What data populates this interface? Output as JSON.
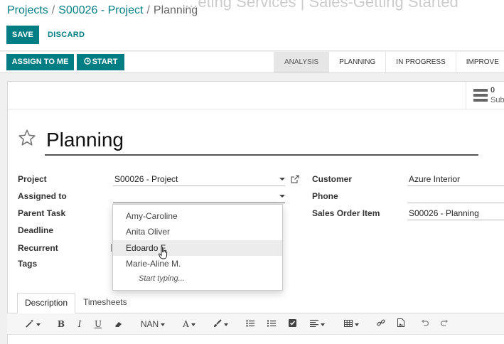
{
  "header": {
    "blurred_title": "...eting Services | Sales-Getting Started",
    "breadcrumbs": [
      {
        "label": "Projects"
      },
      {
        "label": "S00026 - Project"
      },
      {
        "label": "Planning"
      }
    ],
    "separator": "/",
    "save_label": "SAVE",
    "discard_label": "DISCARD"
  },
  "statusbar": {
    "assign_label": "ASSIGN TO ME",
    "start_label": "START",
    "start_icon": "clock-icon",
    "stages": [
      "ANALYSIS",
      "PLANNING",
      "IN PROGRESS",
      "IMPROVE"
    ],
    "active_stage": "ANALYSIS"
  },
  "smart_button": {
    "count": "0",
    "label": "Sub",
    "icon": "list-icon"
  },
  "task": {
    "title": "Planning",
    "favorite_icon": "star-icon"
  },
  "left_fields": {
    "project_label": "Project",
    "project_value": "S00026 - Project",
    "assigned_label": "Assigned to",
    "assigned_value": "",
    "parent_label": "Parent Task",
    "deadline_label": "Deadline",
    "recurrent_label": "Recurrent",
    "tags_label": "Tags"
  },
  "right_fields": {
    "customer_label": "Customer",
    "customer_value": "Azure Interior",
    "phone_label": "Phone",
    "phone_value": "",
    "sales_label": "Sales Order Item",
    "sales_value": "S00026 - Planning"
  },
  "dropdown": {
    "items": [
      "Amy-Caroline",
      "Anita Oliver",
      "Edoardo F.",
      "Marie-Aline M."
    ],
    "hover_index": 2,
    "hint": "Start typing..."
  },
  "tabs": [
    {
      "label": "Description"
    },
    {
      "label": "Timesheets"
    }
  ],
  "toolbar": {
    "bold": "B",
    "italic": "I",
    "underline": "U",
    "font_size": "NAN",
    "font_color": "A"
  },
  "colors": {
    "brand": "#017e84",
    "active_stage_bg": "#e6e6e6"
  }
}
